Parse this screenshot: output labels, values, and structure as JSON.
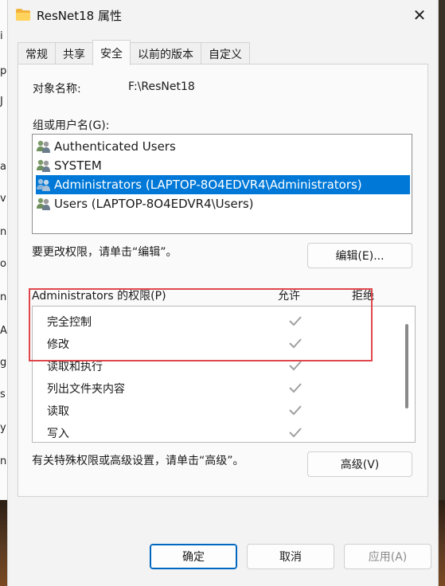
{
  "background": {
    "left_edge_chars": [
      "i",
      "p",
      "J",
      "a",
      "v",
      "n",
      "o",
      "n",
      "A",
      "g",
      "s",
      "y",
      "n"
    ]
  },
  "window": {
    "title": "ResNet18 属性",
    "close_glyph": "✕"
  },
  "tabs": [
    {
      "label": "常规"
    },
    {
      "label": "共享"
    },
    {
      "label": "安全",
      "active": true
    },
    {
      "label": "以前的版本"
    },
    {
      "label": "自定义"
    }
  ],
  "security": {
    "object_name_label": "对象名称:",
    "object_name_value": "F:\\ResNet18",
    "group_label": "组或用户名(G):",
    "users": [
      {
        "name": "Authenticated Users",
        "selected": false
      },
      {
        "name": "SYSTEM",
        "selected": false
      },
      {
        "name": "Administrators (LAPTOP-8O4EDVR4\\Administrators)",
        "selected": true
      },
      {
        "name": "Users (LAPTOP-8O4EDVR4\\Users)",
        "selected": false
      }
    ],
    "change_hint": "要更改权限，请单击“编辑”。",
    "edit_button": "编辑(E)...",
    "perm_title": "Administrators 的权限(P)",
    "allow_header": "允许",
    "deny_header": "拒绝",
    "permissions": [
      {
        "name": "完全控制",
        "allow": true
      },
      {
        "name": "修改",
        "allow": true
      },
      {
        "name": "读取和执行",
        "allow": true
      },
      {
        "name": "列出文件夹内容",
        "allow": true
      },
      {
        "name": "读取",
        "allow": true
      },
      {
        "name": "写入",
        "allow": true
      }
    ],
    "advanced_hint": "有关特殊权限或高级设置，请单击“高级”。",
    "advanced_button": "高级(V)"
  },
  "footer": {
    "ok": "确定",
    "cancel": "取消",
    "apply": "应用(A)"
  },
  "colors": {
    "selection": "#0078d7",
    "highlight_box": "#e0474c",
    "check_gray": "#a0a0a0"
  }
}
